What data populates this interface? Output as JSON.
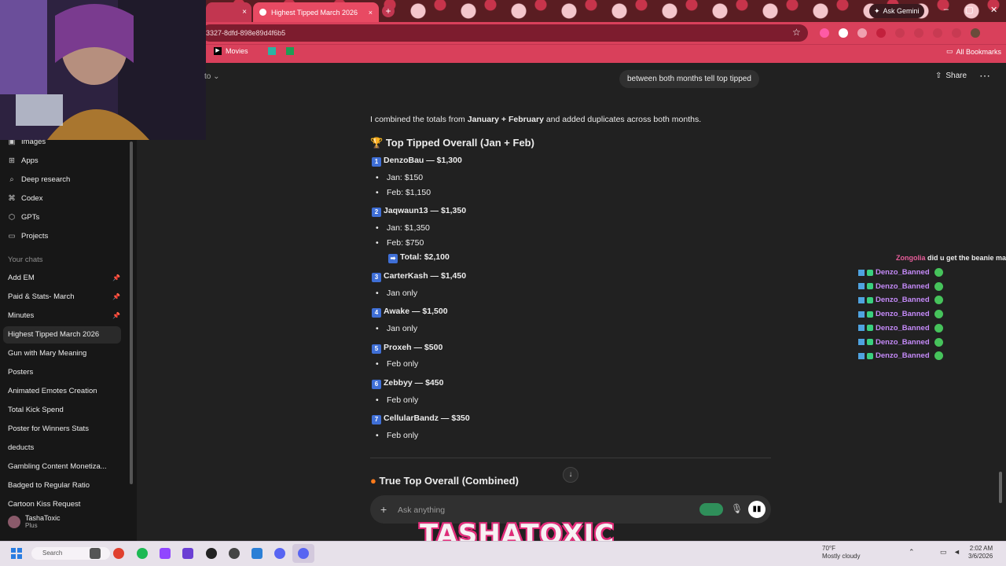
{
  "browser": {
    "prev_tab_close": "×",
    "active_tab_title": "Highest Tipped March 2026",
    "active_tab_close": "×",
    "new_tab": "+",
    "url_fragment": "3327-8dfd-898e89d4f6b5",
    "ask_gemini": "Ask Gemini",
    "bookmark_movies": "Movies",
    "all_bookmarks": "All Bookmarks"
  },
  "sidebar": {
    "nav": [
      {
        "label": "Images",
        "icon": "image-icon"
      },
      {
        "label": "Apps",
        "icon": "apps-icon"
      },
      {
        "label": "Deep research",
        "icon": "research-icon"
      },
      {
        "label": "Codex",
        "icon": "codex-icon"
      },
      {
        "label": "GPTs",
        "icon": "gpts-icon"
      },
      {
        "label": "Projects",
        "icon": "folder-icon"
      }
    ],
    "section_label": "Your chats",
    "chats": [
      "Add EM",
      "Paid & Stats- March",
      "Minutes",
      "Highest Tipped March 2026",
      "Gun with Mary Meaning",
      "Posters",
      "Animated Emotes Creation",
      "Total Kick Spend",
      "Poster for Winners Stats",
      "deducts",
      "Gambling Content Monetiza...",
      "Badged to Regular Ratio",
      "Cartoon Kiss Request"
    ],
    "profile_name": "TashaToxic",
    "profile_plan": "Plus"
  },
  "header": {
    "left_partial": "to",
    "share": "Share"
  },
  "conversation": {
    "user_message": "between both months tell top tipped",
    "intro_pre": "I combined the totals from ",
    "intro_jan_feb": "January + February",
    "intro_post": " and added duplicates across both months.",
    "heading": "Top Tipped Overall (Jan + Feb)",
    "entries": [
      {
        "rank": "1",
        "title": "DenzoBau — $1,300",
        "lines": [
          "Jan: $150",
          "Feb: $1,150"
        ]
      },
      {
        "rank": "2",
        "title": "Jaqwaun13 — $1,350",
        "lines": [
          "Jan: $1,350",
          "Feb: $750"
        ],
        "total": "Total: $2,100"
      },
      {
        "rank": "3",
        "title": "CarterKash — $1,450",
        "lines": [
          "Jan only"
        ]
      },
      {
        "rank": "4",
        "title": "Awake — $1,500",
        "lines": [
          "Jan only"
        ]
      },
      {
        "rank": "5",
        "title": "Proxeh — $500",
        "lines": [
          "Feb only"
        ]
      },
      {
        "rank": "6",
        "title": "Zebbyy — $450",
        "lines": [
          "Feb only"
        ]
      },
      {
        "rank": "7",
        "title": "CellularBandz — $350",
        "lines": [
          "Feb only"
        ]
      }
    ],
    "next_heading": "True Top Overall (Combined)",
    "composer_placeholder": "Ask anything"
  },
  "stream_chat": {
    "first_user": "Zongolia",
    "first_message": "did u get the beanie ma",
    "repeated_user": "Denzo_Banned",
    "repeat_count": 7
  },
  "overlay_brand": "TASHATOXIC",
  "taskbar": {
    "search": "Search",
    "weather_temp": "70°F",
    "weather_desc": "Mostly cloudy",
    "time": "2:02 AM",
    "date": "3/6/2026"
  },
  "colors": {
    "chrome_pink": "#d9405b",
    "chat_bg": "#212121",
    "sidebar_bg": "#171717",
    "stream_user": "#c58af9",
    "stream_first_user": "#e85d9a"
  }
}
